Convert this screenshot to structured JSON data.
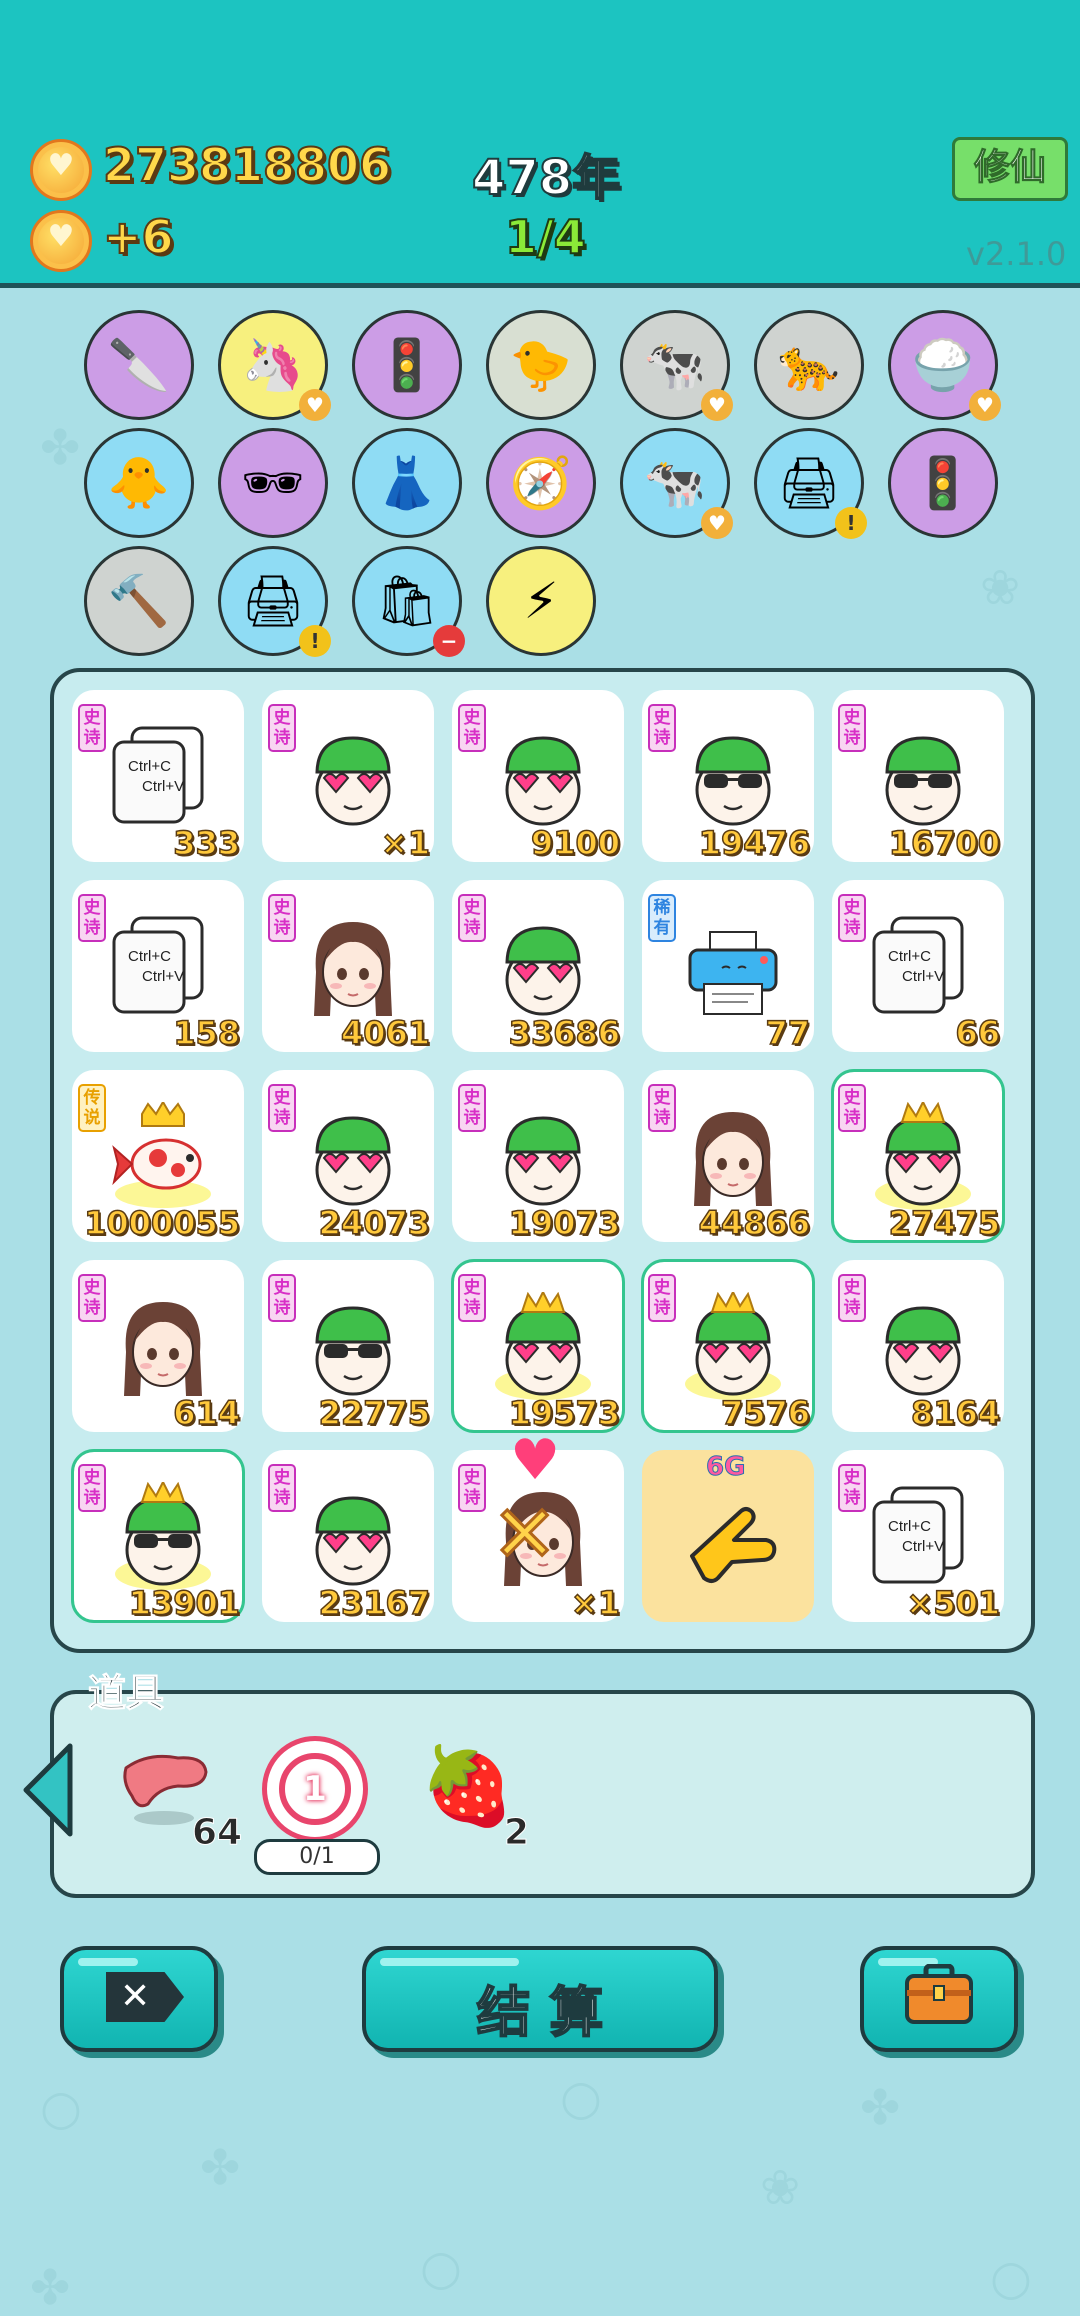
{
  "header": {
    "coins": "273818806",
    "coin_delta": "+6",
    "year": "478年",
    "round": "1/4",
    "xiuxian_label": "修仙",
    "version": "v2.1.0"
  },
  "items": [
    {
      "icon": "cleaver-icon",
      "color": "#cc9de6"
    },
    {
      "icon": "unicorn-icon",
      "color": "#f7f07e"
    },
    {
      "icon": "traffic-light-ghost-icon",
      "color": "#cc9de6"
    },
    {
      "icon": "chick-egg-icon",
      "color": "#d8dfd2"
    },
    {
      "icon": "cows-icon",
      "color": "#cfd3d0"
    },
    {
      "icon": "cheetah-icon",
      "color": "#cfd3d0"
    },
    {
      "icon": "rice-bowl-icon",
      "color": "#cc9de6"
    },
    {
      "icon": "chick-icon",
      "color": "#8fdcf4"
    },
    {
      "icon": "eyepatch-icon",
      "color": "#cc9de6"
    },
    {
      "icon": "skirt-icon",
      "color": "#8fdcf4"
    },
    {
      "icon": "compass-icon",
      "color": "#cc9de6"
    },
    {
      "icon": "cows-icon",
      "color": "#8fdcf4"
    },
    {
      "icon": "printer-icon",
      "color": "#8fdcf4"
    },
    {
      "icon": "traffic-light-ghost-icon",
      "color": "#cc9de6"
    },
    {
      "icon": "hammer-icon",
      "color": "#cfd3d0"
    },
    {
      "icon": "printer-icon",
      "color": "#8fdcf4"
    },
    {
      "icon": "trash-bag-icon",
      "color": "#8fdcf4"
    },
    {
      "icon": "lightning-icon",
      "color": "#f7f07e"
    }
  ],
  "grid": [
    {
      "type": "card",
      "tag": "史诗",
      "value": "333"
    },
    {
      "type": "guy-heart",
      "tag": "史诗",
      "value": "×1"
    },
    {
      "type": "guy-heart",
      "tag": "史诗",
      "value": "9100"
    },
    {
      "type": "guy-shades",
      "tag": "史诗",
      "value": "19476"
    },
    {
      "type": "guy-shades",
      "tag": "史诗",
      "value": "16700"
    },
    {
      "type": "card",
      "tag": "史诗",
      "value": "158"
    },
    {
      "type": "girl",
      "tag": "史诗",
      "value": "4061"
    },
    {
      "type": "guy-heart",
      "tag": "史诗",
      "value": "33686"
    },
    {
      "type": "printer",
      "tag": "稀有",
      "value": "77"
    },
    {
      "type": "card",
      "tag": "史诗",
      "value": "66"
    },
    {
      "type": "fish",
      "tag": "传说",
      "value": "1000055"
    },
    {
      "type": "guy-heart",
      "tag": "史诗",
      "value": "24073"
    },
    {
      "type": "guy-heart",
      "tag": "史诗",
      "value": "19073"
    },
    {
      "type": "girl",
      "tag": "史诗",
      "value": "44866"
    },
    {
      "type": "guy-heart-crown",
      "tag": "史诗",
      "value": "27475",
      "glow": true
    },
    {
      "type": "girl",
      "tag": "史诗",
      "value": "614"
    },
    {
      "type": "guy-shades",
      "tag": "史诗",
      "value": "22775"
    },
    {
      "type": "guy-heart-crown",
      "tag": "史诗",
      "value": "19573",
      "glow": true
    },
    {
      "type": "guy-heart-crown",
      "tag": "史诗",
      "value": "7576",
      "glow": true
    },
    {
      "type": "guy-heart",
      "tag": "史诗",
      "value": "8164"
    },
    {
      "type": "guy-shades-crown",
      "tag": "史诗",
      "value": "13901",
      "glow": true
    },
    {
      "type": "guy-heart",
      "tag": "史诗",
      "value": "23167"
    },
    {
      "type": "girl-x",
      "tag": "史诗",
      "value": "×1"
    },
    {
      "type": "pointer",
      "tag": "",
      "value": "6G"
    },
    {
      "type": "card",
      "tag": "史诗",
      "value": "×501"
    }
  ],
  "card_text": {
    "l1": "Ctrl+C",
    "l2": "Ctrl+V"
  },
  "tools": {
    "label": "道具",
    "liver_count": "64",
    "target_number": "1",
    "target_progress": "0/1",
    "strawberry_count": "2"
  },
  "buttons": {
    "settle_label": "结 算"
  },
  "colors": {
    "header": "#1cc4c1",
    "background": "#aadfe6",
    "epic": "#d82ec7",
    "rare": "#2e84e0",
    "legend": "#e8a000"
  }
}
